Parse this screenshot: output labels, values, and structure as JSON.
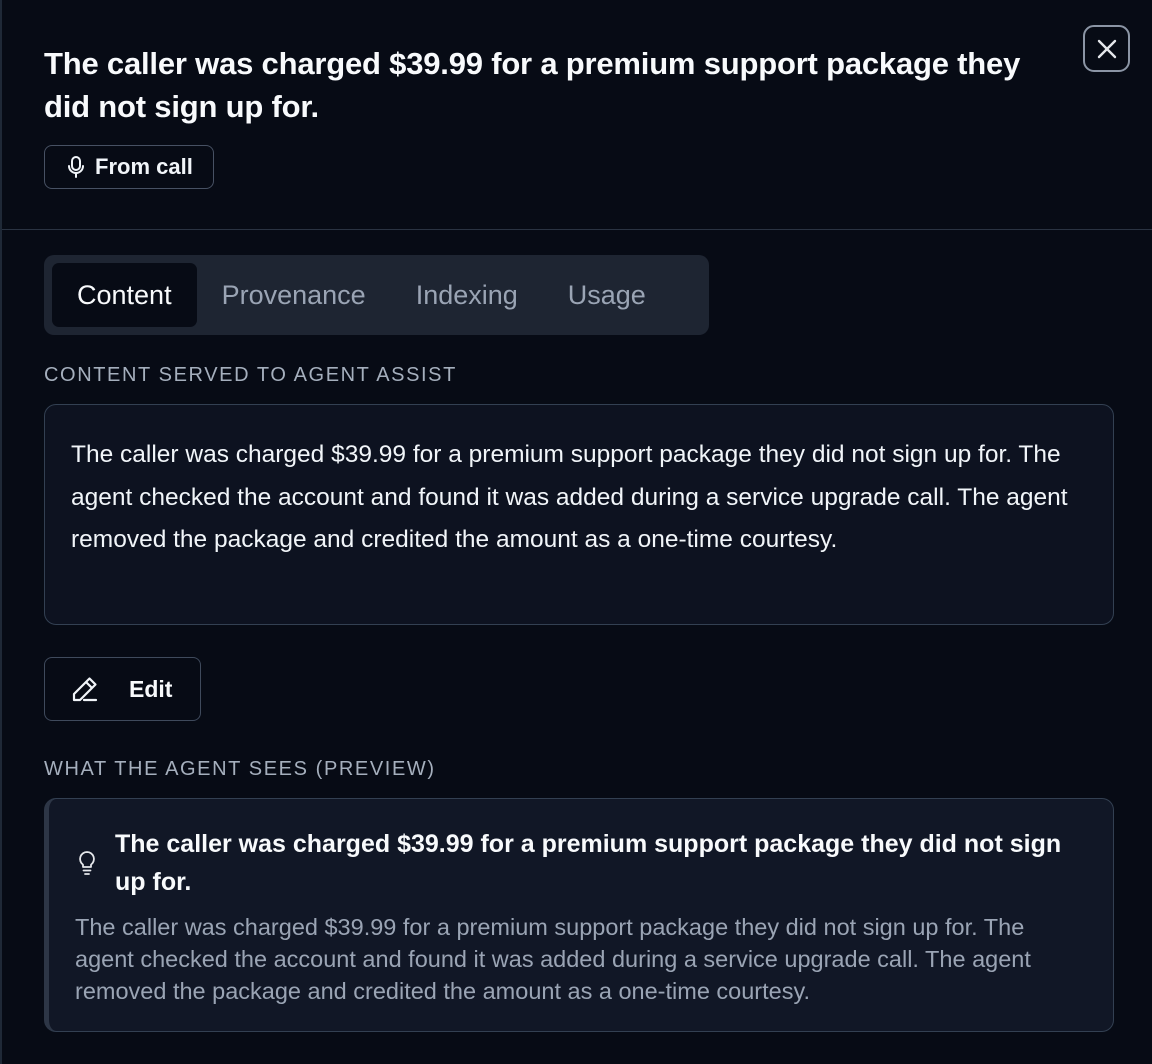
{
  "header": {
    "title": "The caller was charged $39.99 for a premium support package they did not sign up for.",
    "source_badge": "From call",
    "source_icon": "microphone-icon",
    "close_icon": "close-icon"
  },
  "tabs": [
    {
      "label": "Content",
      "active": true
    },
    {
      "label": "Provenance",
      "active": false
    },
    {
      "label": "Indexing",
      "active": false
    },
    {
      "label": "Usage",
      "active": false
    }
  ],
  "content": {
    "section_label": "CONTENT SERVED TO AGENT ASSIST",
    "text": "The caller was charged $39.99 for a premium support package they did not sign up for. The agent checked the account and found it was added during a service upgrade call. The agent removed the package and credited the amount as a one-time courtesy.",
    "edit_label": "Edit",
    "edit_icon": "pencil-icon"
  },
  "preview": {
    "section_label": "WHAT THE AGENT SEES (PREVIEW)",
    "icon": "lightbulb-icon",
    "title": "The caller was charged $39.99 for a premium support package they did not sign up for.",
    "body": "The caller was charged $39.99 for a premium support package they did not sign up for. The agent checked the account and found it was added during a service upgrade call. The agent removed the package and credited the amount as a one-time courtesy."
  }
}
